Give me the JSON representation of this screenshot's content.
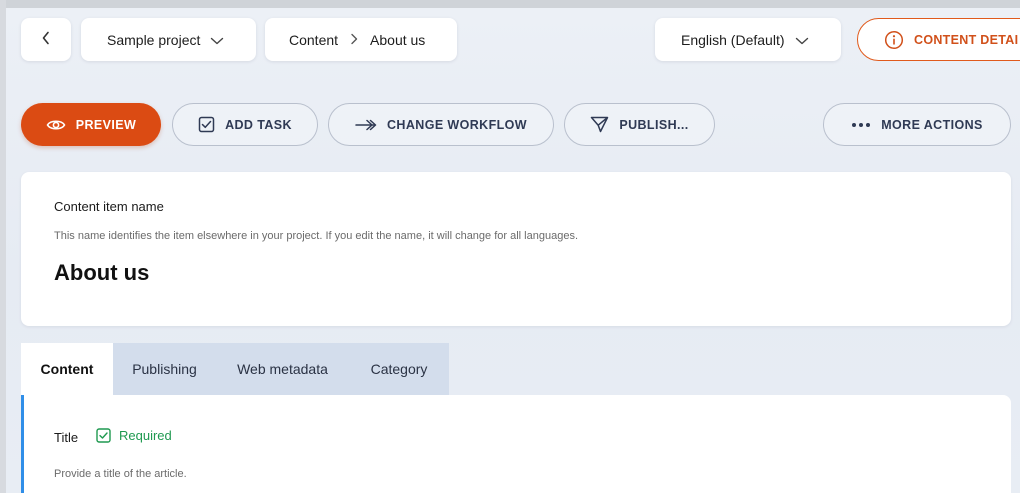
{
  "topbar": {
    "project": "Sample project",
    "breadcrumb": [
      "Content",
      "About us"
    ],
    "language": "English (Default)",
    "content_details": "CONTENT DETAI"
  },
  "actions": {
    "preview": "PREVIEW",
    "add_task": "ADD TASK",
    "change_workflow": "CHANGE WORKFLOW",
    "publish": "PUBLISH...",
    "more_actions": "MORE ACTIONS"
  },
  "item": {
    "label": "Content item name",
    "description": "This name identifies the item elsewhere in your project. If you edit the name, it will change for all languages.",
    "value": "About us"
  },
  "tabs": [
    "Content",
    "Publishing",
    "Web metadata",
    "Category"
  ],
  "active_tab": "Content",
  "field": {
    "label": "Title",
    "required": "Required",
    "description": "Provide a title of the article."
  },
  "colors": {
    "accent": "#db4b13",
    "required": "#1f9950",
    "focus_bar": "#2f8ee8",
    "tab_inactive": "#d3ddec"
  },
  "icons": [
    "chevron-left-icon",
    "chevron-down-icon",
    "chevron-right-icon",
    "info-icon",
    "eye-icon",
    "checkbox-icon",
    "arrow-right-icon",
    "send-icon",
    "ellipsis-icon"
  ]
}
